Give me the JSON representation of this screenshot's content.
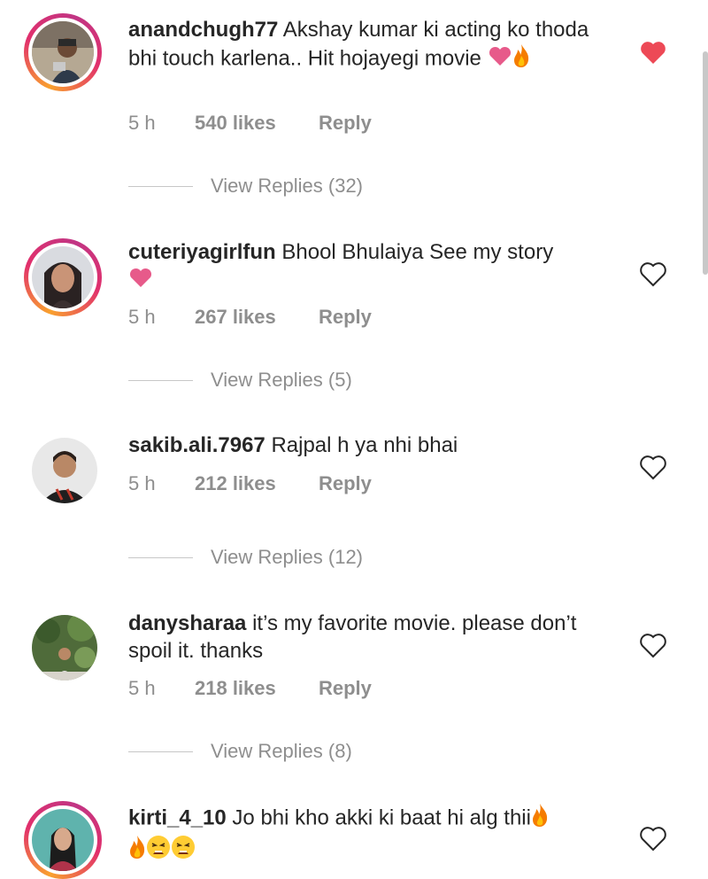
{
  "colors": {
    "heart_liked": "#ed4956",
    "heart_emoji": "#e75a8a",
    "meta_gray": "#8e8e8e",
    "text": "#262626",
    "story_ring_start": "#f9a12e",
    "story_ring_end": "#c13584"
  },
  "comments": [
    {
      "username": "anandchugh77",
      "text": " Akshay kumar ki acting ko thoda bhi touch karlena.. Hit hojayegi movie",
      "emojis": [
        "heart-emoji",
        "fire-emoji"
      ],
      "time": "5 h",
      "likes": "540 likes",
      "reply": "Reply",
      "view_replies": "View Replies (32)",
      "liked": true,
      "story_ring": true
    },
    {
      "username": "cuteriyagirlfun",
      "text": " Bhool Bhulaiya See my story",
      "emojis": [
        "heart-emoji"
      ],
      "time": "5 h",
      "likes": "267 likes",
      "reply": "Reply",
      "view_replies": "View Replies (5)",
      "liked": false,
      "story_ring": true
    },
    {
      "username": "sakib.ali.7967",
      "text": " Rajpal h ya nhi bhai",
      "emojis": [],
      "time": "5 h",
      "likes": "212 likes",
      "reply": "Reply",
      "view_replies": "View Replies (12)",
      "liked": false,
      "story_ring": false
    },
    {
      "username": "danysharaa",
      "text": " it’s my favorite movie. please don’t spoil it. thanks",
      "emojis": [],
      "time": "5 h",
      "likes": "218 likes",
      "reply": "Reply",
      "view_replies": "View Replies (8)",
      "liked": false,
      "story_ring": false
    },
    {
      "username": "kirti_4_10",
      "text": " Jo bhi kho akki ki baat hi alg thii",
      "emojis": [
        "fire-emoji",
        "fire-emoji",
        "tired-face-emoji",
        "tired-face-emoji"
      ],
      "liked": false,
      "story_ring": true
    }
  ]
}
